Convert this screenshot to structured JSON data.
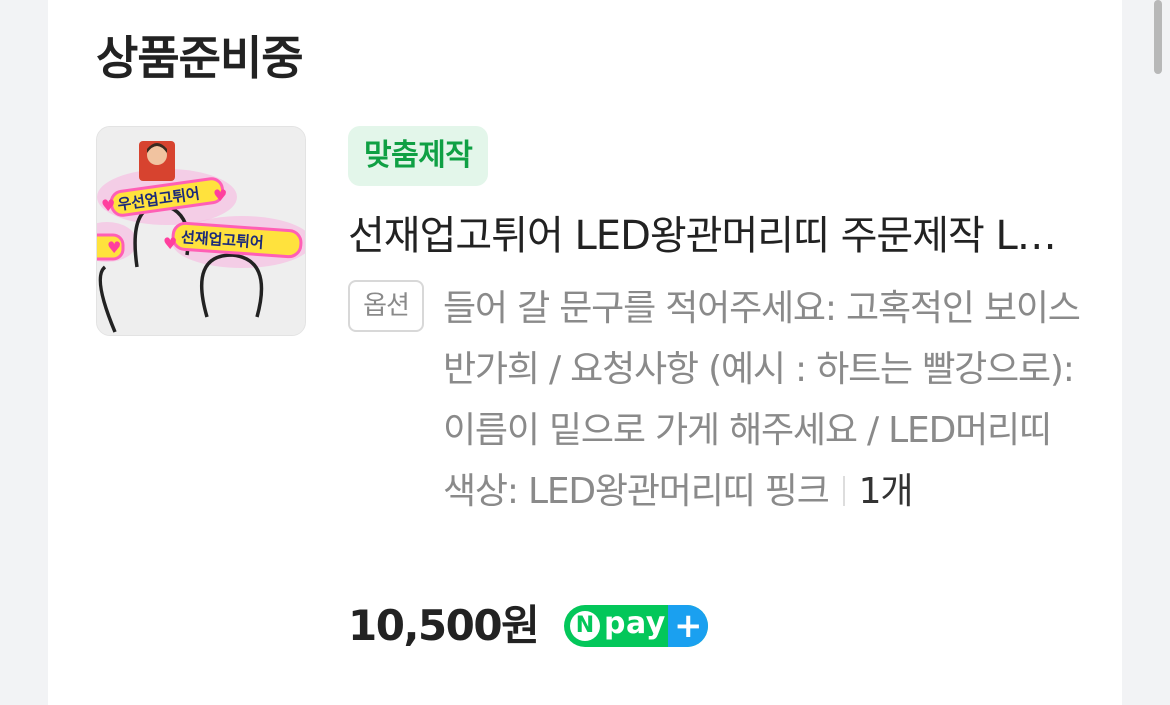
{
  "section": {
    "title": "상품준비중"
  },
  "product": {
    "image_alt": "LED 머리띠 상품 이미지",
    "image_texts": {
      "headband_1": "우선업고튀어",
      "headband_2": "선재업고튀어"
    },
    "badge": "맞춤제작",
    "title": "선재업고튀어 LED왕관머리띠 주문제작 LED 머리띠",
    "option_tag": "옵션",
    "option_text": "들어 갈 문구를 적어주세요: 고혹적인 보이스 반가희 / 요청사항 (예시 : 하트는 빨강으로): 이름이 밑으로 가게 해주세요 / LED머리띠 색상: LED왕관머리띠 핑크",
    "quantity": "1개",
    "price": "10,500원"
  },
  "npay": {
    "n": "N",
    "text": "pay",
    "plus": "+"
  },
  "colors": {
    "badge_bg": "#e3f6ea",
    "badge_text": "#0fa044",
    "npay_green": "#03c75a",
    "npay_blue": "#1aa0f0"
  }
}
